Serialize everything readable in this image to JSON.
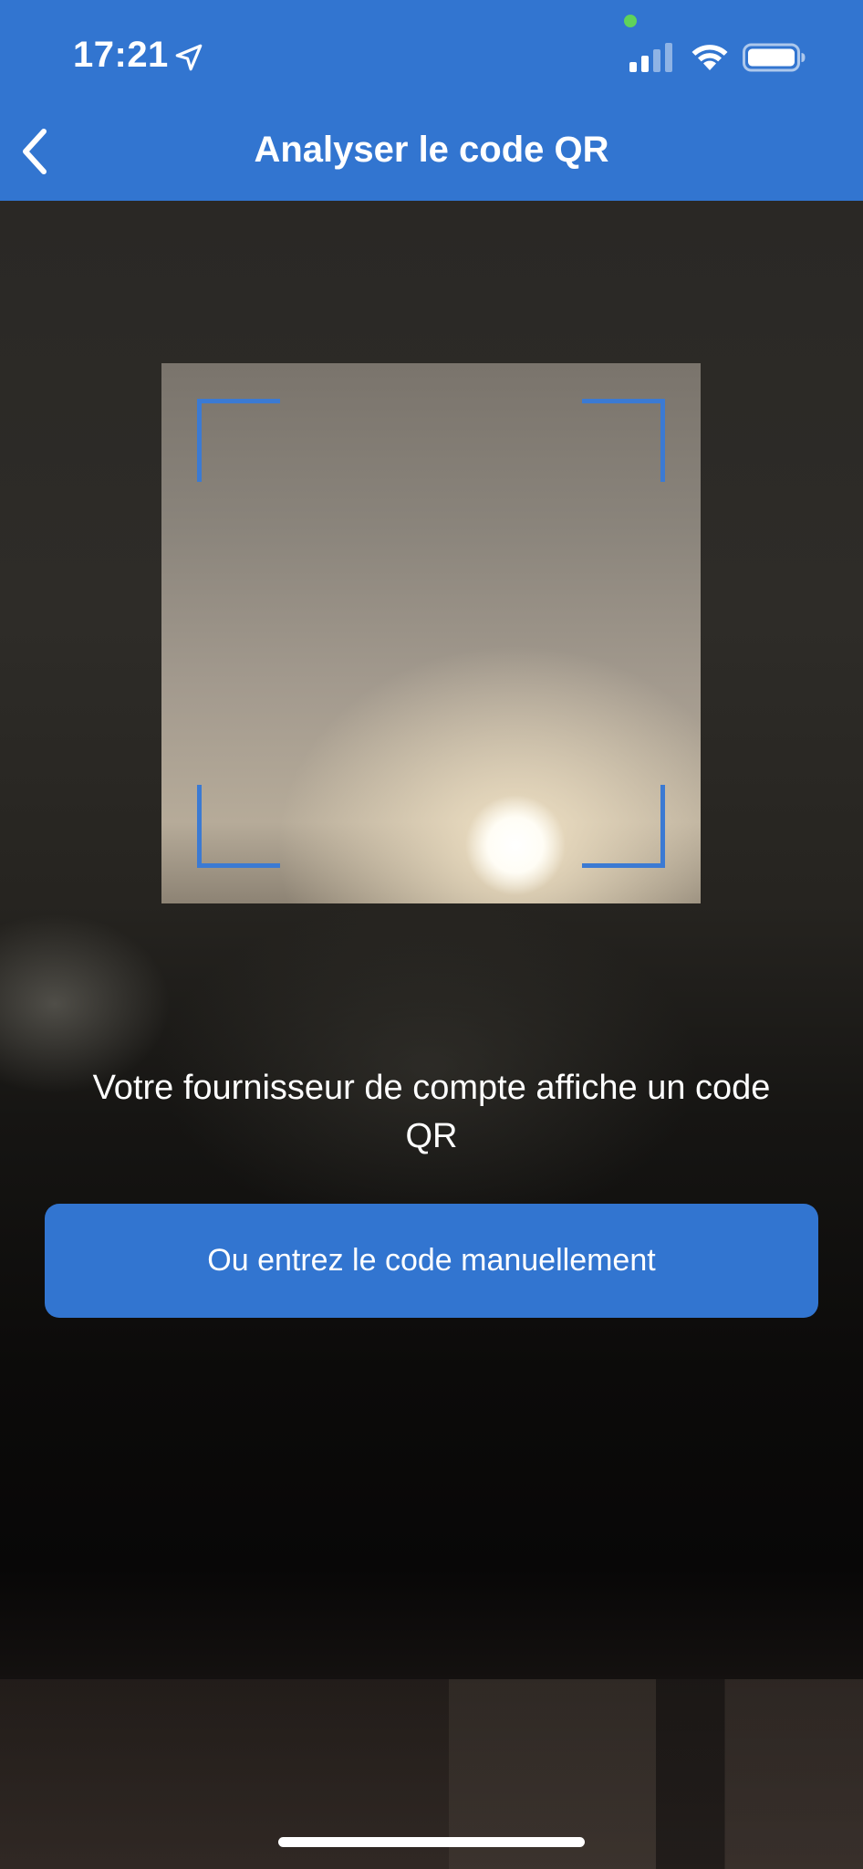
{
  "status_bar": {
    "time": "17:21",
    "icons": [
      "location-arrow-icon",
      "privacy-indicator-dot",
      "signal-icon",
      "wifi-icon",
      "battery-icon"
    ],
    "privacy_dot_color": "#5fd35a"
  },
  "header": {
    "title": "Analyser le code QR",
    "back_icon": "chevron-left-icon",
    "background_color": "#3275d0"
  },
  "scanner": {
    "corner_color": "#3b7ad3"
  },
  "instruction": {
    "text": "Votre fournisseur de compte affiche un code QR"
  },
  "manual_entry": {
    "label": "Ou entrez le code manuellement",
    "color": "#3275d0"
  }
}
